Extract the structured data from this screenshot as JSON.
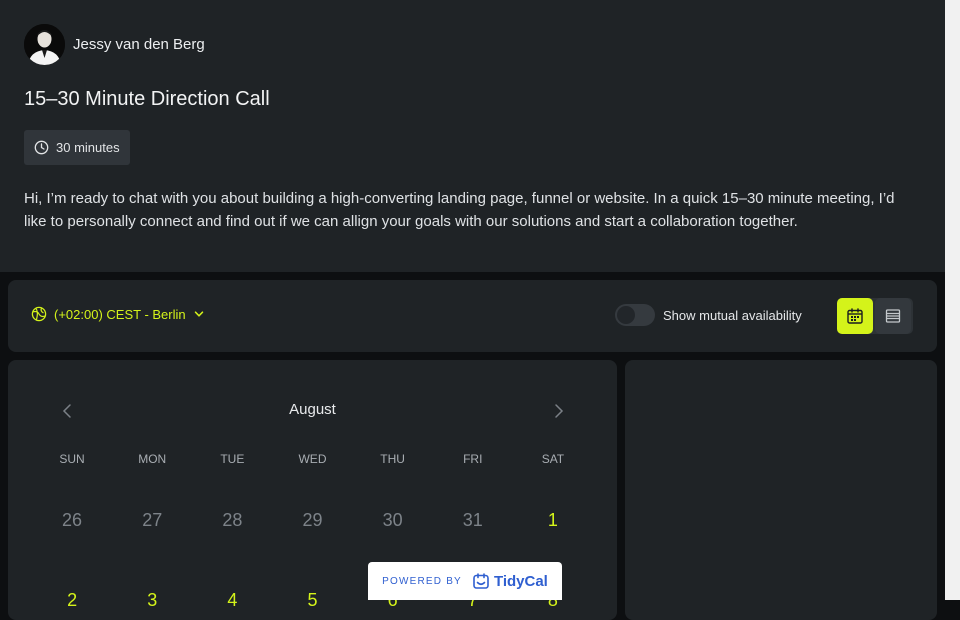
{
  "host": {
    "name": "Jessy van den Berg"
  },
  "event": {
    "title": "15–30 Minute Direction Call",
    "duration": "30 minutes",
    "description": "Hi, I’m ready to chat with you about building a high-converting landing page, funnel or website. In a quick 15–30 minute meeting, I’d like to personally connect and find out if we can allign your goals with our solutions and start a collaboration together."
  },
  "toolbar": {
    "timezone": "(+02:00) CEST - Berlin",
    "mutual_label": "Show mutual availability",
    "mutual_enabled": false
  },
  "calendar": {
    "month": "August",
    "weekdays": [
      "SUN",
      "MON",
      "TUE",
      "WED",
      "THU",
      "FRI",
      "SAT"
    ],
    "week1": [
      "26",
      "27",
      "28",
      "29",
      "30",
      "31",
      "1"
    ],
    "week2": [
      "2",
      "3",
      "4",
      "5",
      "6",
      "7",
      "8"
    ]
  },
  "footer": {
    "powered_by": "POWERED BY",
    "brand": "TidyCal"
  },
  "colors": {
    "accent": "#d4f31a",
    "panel": "#1f2326",
    "background": "#0d0f11",
    "brand": "#2f5fd0"
  }
}
